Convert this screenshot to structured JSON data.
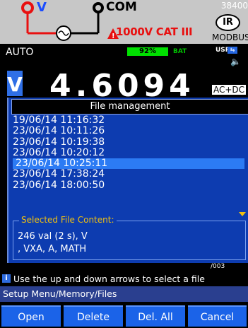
{
  "diagram": {
    "v_label": "V",
    "com_label": "COM",
    "cat_label": "1000V CAT III",
    "baud": "38400",
    "ir_label": "IR",
    "modbus_label": "MODBUS",
    "colors": {
      "v_terminal": "#e81010",
      "com_terminal": "#000000",
      "warning": "#e81010",
      "background": "#c7c7c7"
    }
  },
  "status": {
    "mode": "AUTO",
    "battery_level": "92%",
    "battery_label": "BAT",
    "usr_label": "USR"
  },
  "measurement": {
    "unit_badge": "V",
    "value": "4.6094",
    "coupling": "AC+DC"
  },
  "dialog": {
    "title": "File management",
    "files": [
      {
        "label": "19/06/14 11:16:32",
        "selected": false
      },
      {
        "label": "23/06/14 10:11:26",
        "selected": false
      },
      {
        "label": "23/06/14 10:19:38",
        "selected": false
      },
      {
        "label": "23/06/14 10:20:12",
        "selected": false
      },
      {
        "label": "23/06/14 10:25:11",
        "selected": true
      },
      {
        "label": "23/06/14 17:38:24",
        "selected": false
      },
      {
        "label": "23/06/14 18:00:50",
        "selected": false
      }
    ],
    "content_heading": "Selected File Content:",
    "content_line1": "246 val (2 s), V",
    "content_line2": ", VXA, A, MATH"
  },
  "stub": "/003",
  "info": {
    "icon": "i",
    "text": "Use the up and down arrows to select a file"
  },
  "breadcrumb": "Setup Menu/Memory/Files",
  "softkeys": [
    "Open",
    "Delete",
    "Del. All",
    "Cancel"
  ]
}
